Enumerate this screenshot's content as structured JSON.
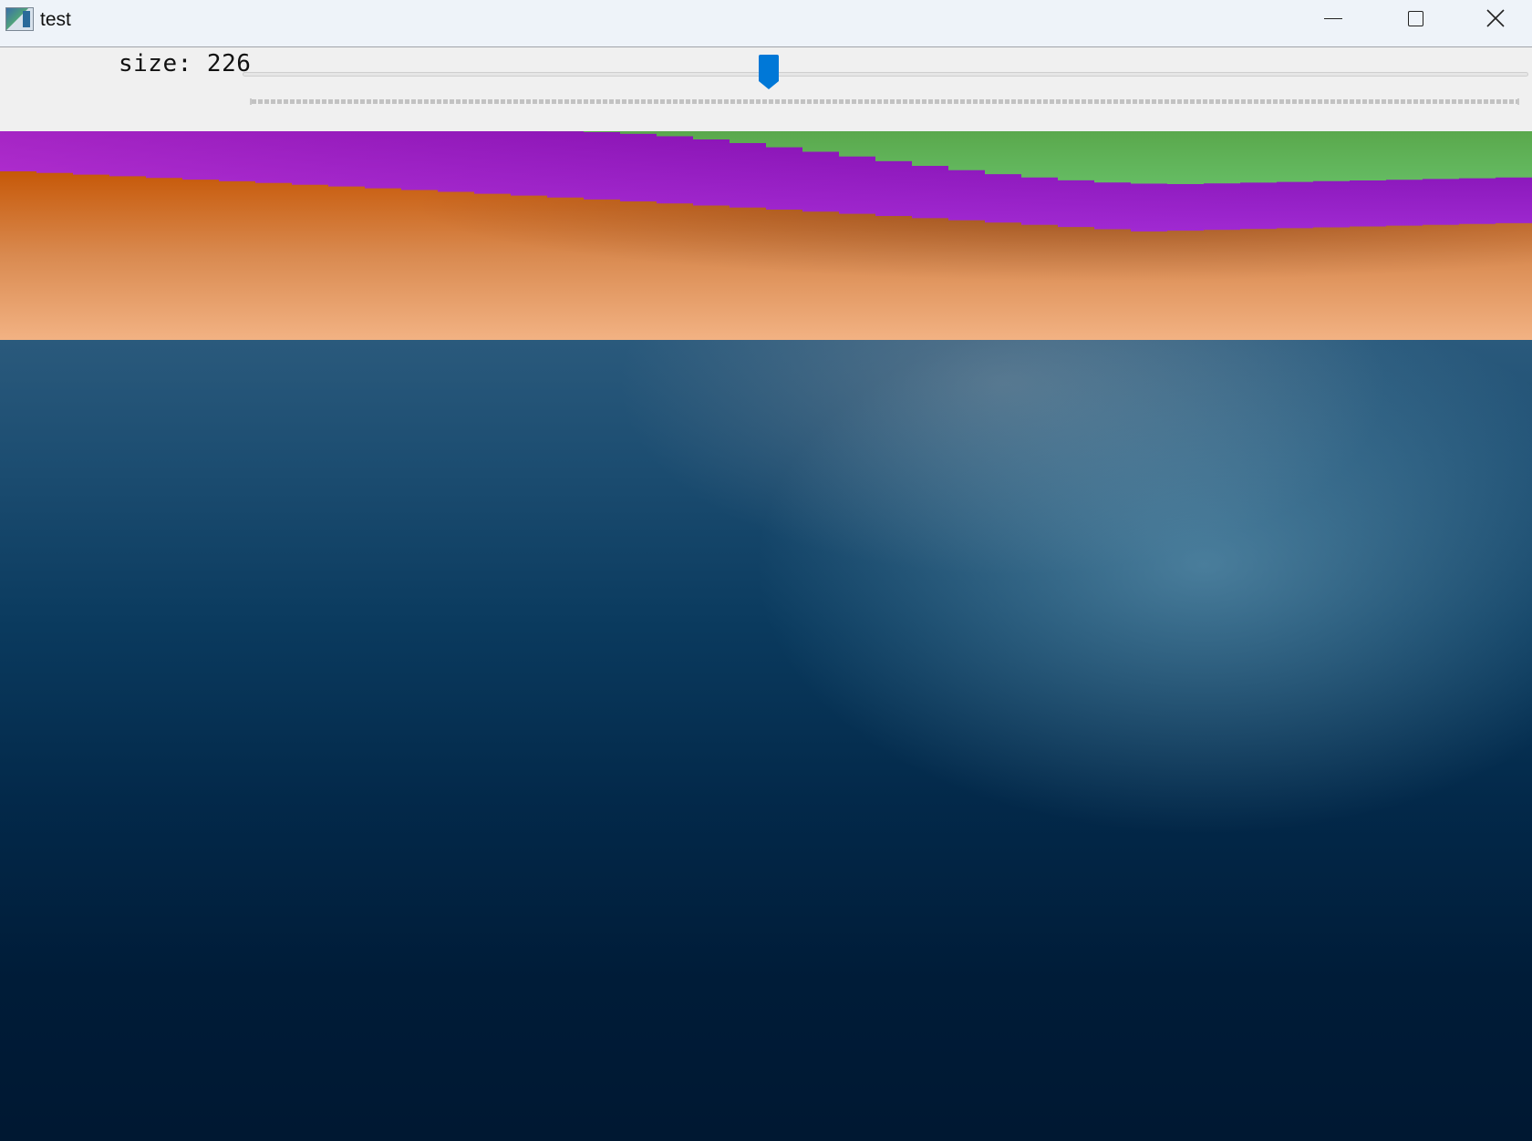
{
  "window": {
    "title": "test",
    "icon": "app-window-icon",
    "controls": {
      "minimize_icon": "minimize-icon",
      "maximize_icon": "maximize-icon",
      "close_icon": "close-icon"
    }
  },
  "controls": {
    "size_label": "size: 226",
    "size_value": 226,
    "slider_fraction": 0.405,
    "accent_color": "#0078d7"
  },
  "colors": {
    "green_band": "#7cf09a",
    "purple_band": "#b13cf0",
    "orange_band": "#d2640c",
    "peach_band": "#f0b080"
  }
}
